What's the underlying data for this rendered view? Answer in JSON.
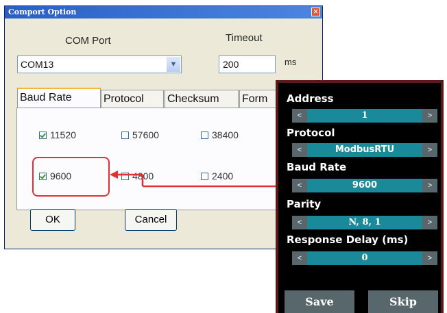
{
  "dialog": {
    "title": "Comport Option",
    "com_port_label": "COM Port",
    "com_port_value": "COM13",
    "timeout_label": "Timeout",
    "timeout_value": "200",
    "timeout_unit": "ms",
    "tabs": [
      "Baud Rate",
      "Protocol",
      "Checksum",
      "Form"
    ],
    "baud_options": [
      {
        "label": "11520",
        "checked": true
      },
      {
        "label": "57600",
        "checked": false
      },
      {
        "label": "38400",
        "checked": false
      },
      {
        "label": "9600",
        "checked": true
      },
      {
        "label": "4800",
        "checked": false
      },
      {
        "label": "2400",
        "checked": false
      }
    ],
    "ok_label": "OK",
    "cancel_label": "Cancel"
  },
  "device": {
    "fields": [
      {
        "label": "Address",
        "value": "1"
      },
      {
        "label": "Protocol",
        "value": "ModbusRTU"
      },
      {
        "label": "Baud Rate",
        "value": "9600"
      },
      {
        "label": "Parity",
        "value": "N, 8, 1"
      },
      {
        "label": "Response Delay (ms)",
        "value": "0"
      }
    ],
    "prev_glyph": "<",
    "next_glyph": ">",
    "save_label": "Save",
    "skip_label": "Skip"
  },
  "colors": {
    "highlight": "#e03030",
    "device_bar": "#1a8a9a",
    "device_button": "#58676b"
  }
}
